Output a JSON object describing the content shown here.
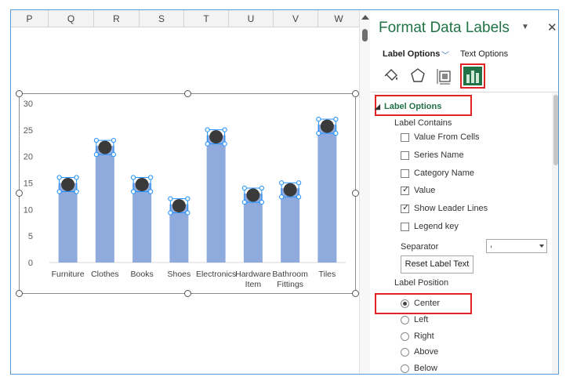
{
  "sheet": {
    "columns": [
      "P",
      "Q",
      "R",
      "S",
      "T",
      "U",
      "V",
      "W"
    ]
  },
  "chart_data": {
    "type": "bar",
    "categories": [
      "Furniture",
      "Clothes",
      "Books",
      "Shoes",
      "Electronics",
      "Hardware Item",
      "Bathroom Fittings",
      "Tiles"
    ],
    "category_lines": [
      [
        "Furniture"
      ],
      [
        "Clothes"
      ],
      [
        "Books"
      ],
      [
        "Shoes"
      ],
      [
        "Electronics"
      ],
      [
        "Hardware",
        "Item"
      ],
      [
        "Bathroom",
        "Fittings"
      ],
      [
        "Tiles"
      ]
    ],
    "values": [
      15,
      22,
      15,
      11,
      24,
      13,
      14,
      26
    ],
    "yticks": [
      "30",
      "25",
      "20",
      "15",
      "10",
      "5",
      "0"
    ],
    "ylim": [
      0,
      30
    ],
    "title": "",
    "xlabel": "",
    "ylabel": "",
    "grid": false,
    "legend": "none",
    "bar_color": "#8faadc",
    "label_marker_color": "#3a3a3a",
    "selection_color": "#1e90ff"
  },
  "pane": {
    "title": "Format Data Labels",
    "tabs": {
      "label_options": "Label Options",
      "text_options": "Text Options"
    },
    "icons": [
      "fill-line-icon",
      "effects-icon",
      "size-properties-icon",
      "label-options-icon"
    ],
    "section_title": "Label Options",
    "label_contains": "Label Contains",
    "checkboxes": [
      {
        "label": "Value From Cells",
        "checked": false
      },
      {
        "label": "Series Name",
        "checked": false
      },
      {
        "label": "Category Name",
        "checked": false
      },
      {
        "label": "Value",
        "checked": true
      },
      {
        "label": "Show Leader Lines",
        "checked": true
      },
      {
        "label": "Legend key",
        "checked": false
      }
    ],
    "separator": {
      "label": "Separator",
      "value": ","
    },
    "reset_button": "Reset Label Text",
    "label_position": "Label Position",
    "positions": [
      {
        "label": "Center",
        "selected": true
      },
      {
        "label": "Left",
        "selected": false
      },
      {
        "label": "Right",
        "selected": false
      },
      {
        "label": "Above",
        "selected": false
      },
      {
        "label": "Below",
        "selected": false
      }
    ],
    "accent_color": "#217346",
    "highlight_color": "#e02424"
  }
}
